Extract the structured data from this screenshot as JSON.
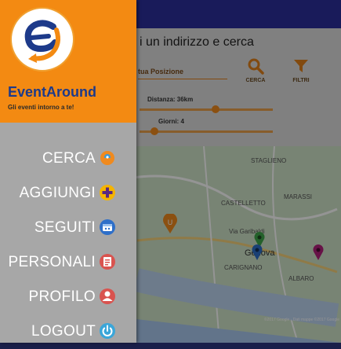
{
  "search": {
    "hint_visible": "i un indirizzo e cerca",
    "position_label_visible": "tua Posizione",
    "cerca_label": "CERCA",
    "filtri_label": "FILTRI",
    "distance_label": "Distanza: 36km",
    "days_label": "Giorni: 4"
  },
  "map": {
    "labels": [
      "CASTELLETTO",
      "MARASSI",
      "Via Garibaldi",
      "Genova",
      "CARIGNANO",
      "ALBARO",
      "STAGLIENO"
    ],
    "attribution": "©2017 Google · Dati mappe ©2017 Google"
  },
  "drawer": {
    "brand_name": "EventAround",
    "tagline": "Gli eventi intorno a te!",
    "items": [
      {
        "label": "CERCA",
        "icon": "search-location-icon",
        "color": "#f08a1e"
      },
      {
        "label": "AGGIUNGI",
        "icon": "plus-circle-icon",
        "color": "#f5b400"
      },
      {
        "label": "SEGUITI",
        "icon": "followed-icon",
        "color": "#2e6fc9"
      },
      {
        "label": "PERSONALI",
        "icon": "personal-events-icon",
        "color": "#d9534f"
      },
      {
        "label": "PROFILO",
        "icon": "profile-icon",
        "color": "#d9534f"
      },
      {
        "label": "LOGOUT",
        "icon": "logout-icon",
        "color": "#3aa6d9"
      }
    ]
  },
  "colors": {
    "accent": "#f38a12",
    "brand_blue": "#1d3a8a",
    "appbar": "#2b2f9c"
  }
}
